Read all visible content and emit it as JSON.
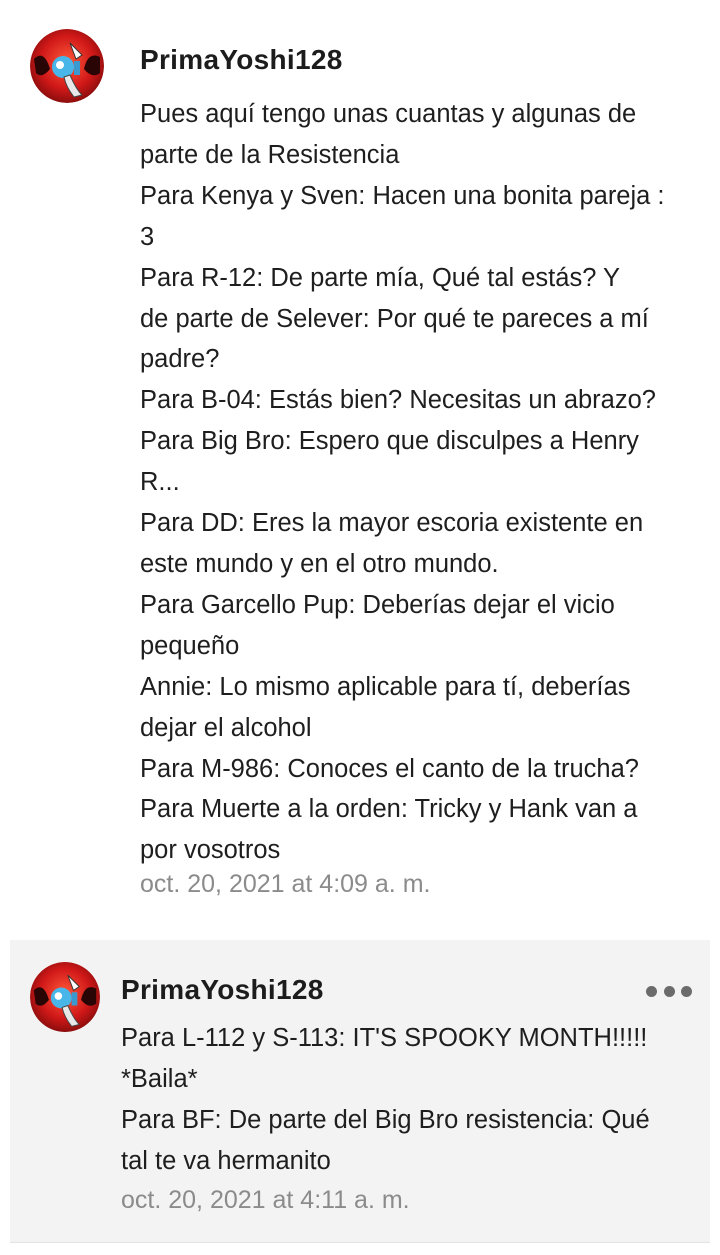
{
  "colors": {
    "card_bg": "#f3f3f3",
    "timestamp": "#8b8b8b",
    "text": "#1e1e1e"
  },
  "comments": [
    {
      "author": "PrimaYoshi128",
      "avatar_icon": "red-circle-creature-avatar-icon",
      "lines": [
        "Pues aquí tengo unas cuantas y algunas de",
        "parte de la Resistencia",
        "Para Kenya y Sven: Hacen una bonita pareja :",
        "3",
        "Para R-12: De parte mía, Qué tal estás? Y",
        "de parte de Selever: Por qué te pareces a mí",
        "padre?",
        "Para B-04: Estás bien? Necesitas un abrazo?",
        "Para Big Bro: Espero que disculpes a Henry",
        "R...",
        "Para DD: Eres la mayor escoria existente en",
        "este mundo y en el otro mundo.",
        "Para Garcello Pup: Deberías dejar el vicio",
        "pequeño",
        "Annie: Lo mismo aplicable para tí, deberías",
        "dejar el alcohol",
        "Para M-986: Conoces el canto de la trucha?",
        "Para Muerte a la orden: Tricky y Hank van a",
        "por vosotros"
      ],
      "timestamp": "oct. 20, 2021 at 4:09 a. m."
    },
    {
      "author": "PrimaYoshi128",
      "avatar_icon": "red-circle-creature-avatar-icon",
      "more_icon": "more-options-icon",
      "lines": [
        "Para L-112 y S-113: IT'S SPOOKY MONTH!!!!!",
        "*Baila*",
        "Para BF: De parte del Big Bro resistencia: Qué",
        "tal te va hermanito"
      ],
      "timestamp": "oct. 20, 2021 at 4:11 a. m."
    }
  ]
}
